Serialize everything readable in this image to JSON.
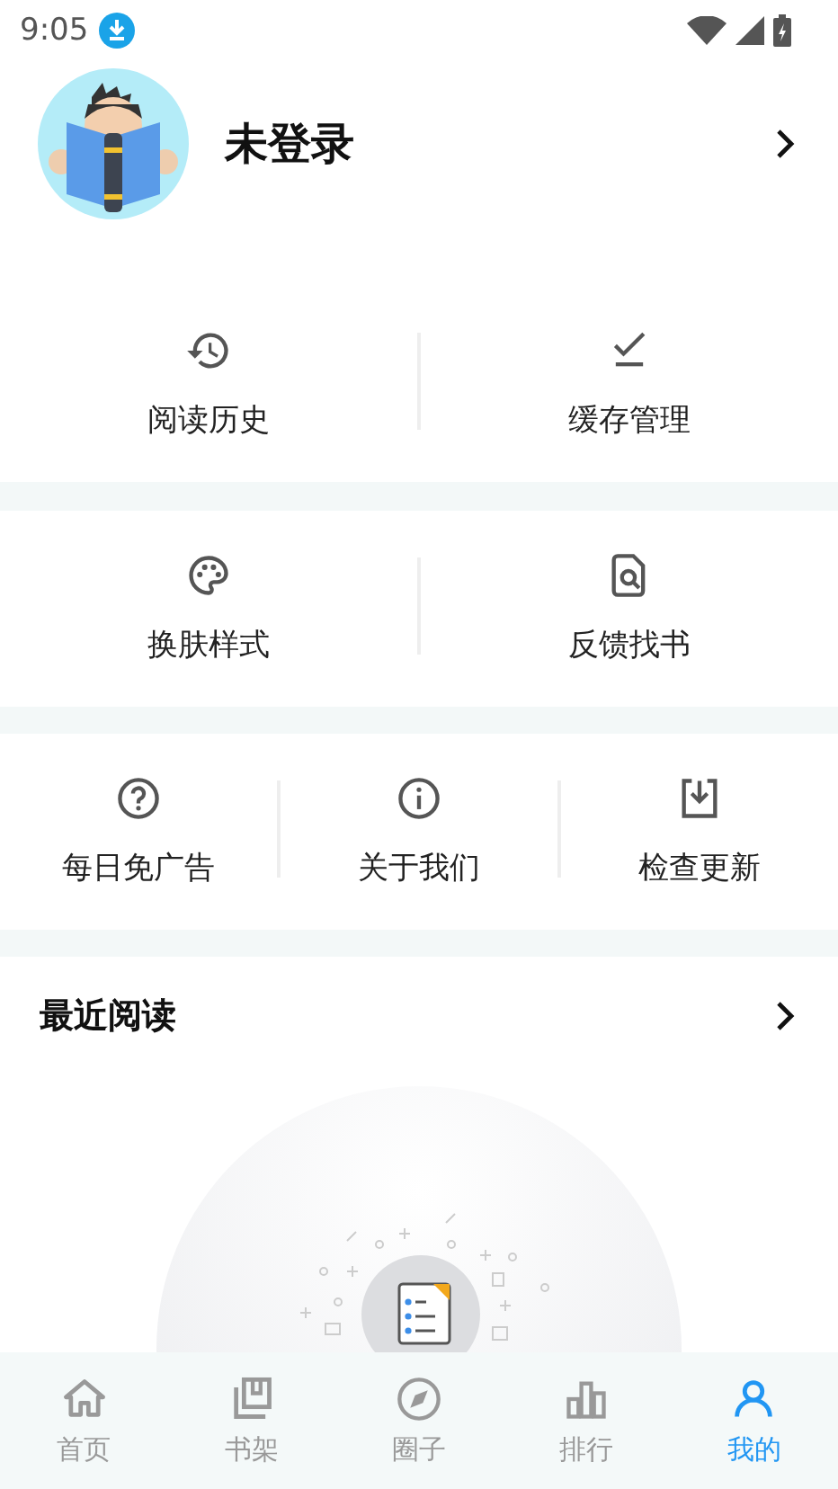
{
  "status_bar": {
    "time": "9:05"
  },
  "profile": {
    "name": "未登录"
  },
  "menu_groups": [
    {
      "items": [
        {
          "label": "阅读历史",
          "kind": "history"
        },
        {
          "label": "缓存管理",
          "kind": "cached"
        }
      ]
    },
    {
      "items": [
        {
          "label": "换肤样式",
          "kind": "palette"
        },
        {
          "label": "反馈找书",
          "kind": "find-book"
        }
      ]
    },
    {
      "items": [
        {
          "label": "每日免广告",
          "kind": "help"
        },
        {
          "label": "关于我们",
          "kind": "info"
        },
        {
          "label": "检查更新",
          "kind": "update"
        }
      ]
    }
  ],
  "recent": {
    "title": "最近阅读"
  },
  "bottom_nav": [
    {
      "label": "首页",
      "kind": "home",
      "selected": false
    },
    {
      "label": "书架",
      "kind": "shelf",
      "selected": false
    },
    {
      "label": "圈子",
      "kind": "compass",
      "selected": false
    },
    {
      "label": "排行",
      "kind": "rank",
      "selected": false
    },
    {
      "label": "我的",
      "kind": "me",
      "selected": true
    }
  ]
}
